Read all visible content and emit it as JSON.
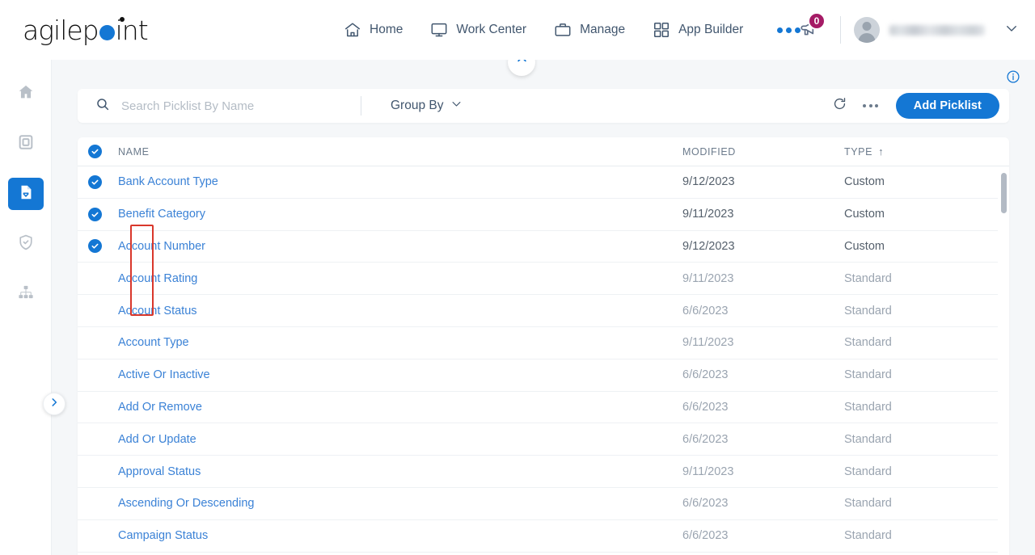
{
  "brand": {
    "name_part1": "agilep",
    "name_part2": "int",
    "dot": "o",
    "color": "#1477d4"
  },
  "header": {
    "nav": [
      {
        "label": "Home",
        "icon": "home-icon"
      },
      {
        "label": "Work Center",
        "icon": "monitor-icon"
      },
      {
        "label": "Manage",
        "icon": "briefcase-icon"
      },
      {
        "label": "App Builder",
        "icon": "grid-icon"
      }
    ],
    "more_label": "",
    "notification_count": "0",
    "username": "",
    "badge_color": "#a51b66"
  },
  "left_rail": {
    "items": [
      {
        "name": "home",
        "icon": "home-icon",
        "active": false
      },
      {
        "name": "app",
        "icon": "monitor-icon",
        "active": false
      },
      {
        "name": "data-entities",
        "icon": "document-check-icon",
        "active": true
      },
      {
        "name": "access",
        "icon": "shield-check-icon",
        "active": false
      },
      {
        "name": "org-chart",
        "icon": "hierarchy-icon",
        "active": false
      }
    ]
  },
  "toolbar": {
    "search_placeholder": "Search Picklist By Name",
    "search_value": "",
    "group_by_label": "Group By",
    "refresh_icon": "refresh-icon",
    "more_icon": "ellipsis-icon",
    "add_label": "Add Picklist",
    "accent": "#1477d4"
  },
  "table": {
    "columns": {
      "name": "NAME",
      "modified": "MODIFIED",
      "type": "TYPE"
    },
    "sort_indicator": "↑",
    "header_all_selected": true,
    "rows": [
      {
        "name": "Bank Account Type",
        "modified": "9/12/2023",
        "type": "Custom",
        "selected": true
      },
      {
        "name": "Benefit Category",
        "modified": "9/11/2023",
        "type": "Custom",
        "selected": true
      },
      {
        "name": "Account Number",
        "modified": "9/12/2023",
        "type": "Custom",
        "selected": true
      },
      {
        "name": "Account Rating",
        "modified": "9/11/2023",
        "type": "Standard",
        "selected": false
      },
      {
        "name": "Account Status",
        "modified": "6/6/2023",
        "type": "Standard",
        "selected": false
      },
      {
        "name": "Account Type",
        "modified": "9/11/2023",
        "type": "Standard",
        "selected": false
      },
      {
        "name": "Active Or Inactive",
        "modified": "6/6/2023",
        "type": "Standard",
        "selected": false
      },
      {
        "name": "Add Or Remove",
        "modified": "6/6/2023",
        "type": "Standard",
        "selected": false
      },
      {
        "name": "Add Or Update",
        "modified": "6/6/2023",
        "type": "Standard",
        "selected": false
      },
      {
        "name": "Approval Status",
        "modified": "9/11/2023",
        "type": "Standard",
        "selected": false
      },
      {
        "name": "Ascending Or Descending",
        "modified": "6/6/2023",
        "type": "Standard",
        "selected": false
      },
      {
        "name": "Campaign Status",
        "modified": "6/6/2023",
        "type": "Standard",
        "selected": false
      }
    ]
  },
  "annotation": {
    "highlight_color": "#d9372b",
    "target": "row-checkboxes"
  },
  "misc": {
    "info_icon": "info-icon",
    "collapse_icon": "chevron-up-icon",
    "expand_rail_icon": "chevron-right-icon"
  }
}
